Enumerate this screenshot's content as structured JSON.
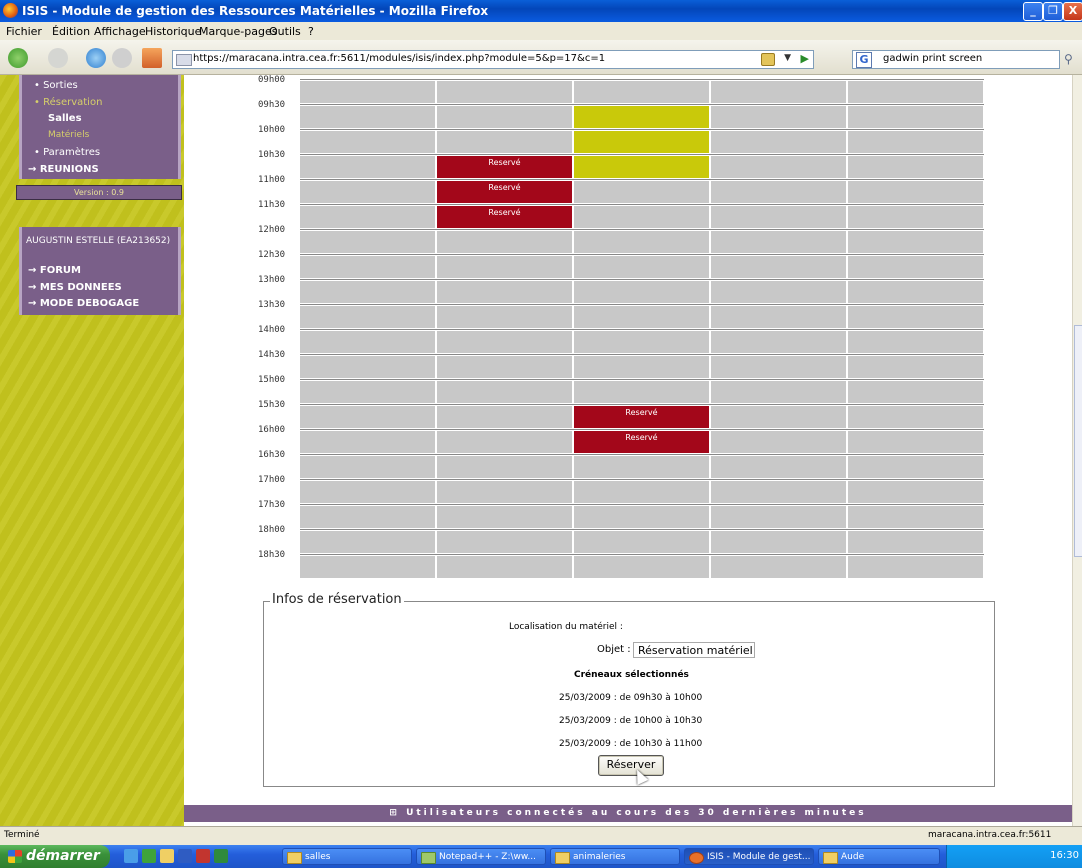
{
  "window": {
    "title": "ISIS - Module de gestion des Ressources Matérielles - Mozilla Firefox",
    "buttons": [
      "_",
      "❐",
      "X"
    ]
  },
  "menu": [
    "Fichier",
    "Édition",
    "Affichage",
    "Historique",
    "Marque-pages",
    "Outils",
    "?"
  ],
  "nav": {
    "url": "https://maracana.intra.cea.fr:5611/modules/isis/index.php?module=5&p=17&c=1",
    "search_value": "gadwin print screen",
    "search_engine": "G"
  },
  "sidebar": {
    "menu_items": [
      {
        "label": "• Sorties",
        "style": "normal"
      },
      {
        "label": "• Réservation",
        "style": "active"
      },
      {
        "label": "Salles",
        "style": "sub-bold"
      },
      {
        "label": "Matériels",
        "style": "sub-active"
      },
      {
        "label": "• Paramètres",
        "style": "normal"
      },
      {
        "label": "→ REUNIONS",
        "style": "bold"
      }
    ],
    "version": "Version : 0.9",
    "user": "AUGUSTIN ESTELLE (EA213652)",
    "user_links": [
      "→ FORUM",
      "→ MES DONNEES",
      "→ MODE DEBOGAGE"
    ]
  },
  "schedule": {
    "time_labels": [
      "09h00",
      "09h30",
      "10h00",
      "10h30",
      "11h00",
      "11h30",
      "12h00",
      "12h30",
      "13h00",
      "13h30",
      "14h00",
      "14h30",
      "15h00",
      "15h30",
      "16h00",
      "16h30",
      "17h00",
      "17h30",
      "18h00",
      "18h30"
    ],
    "columns": 5,
    "reserved_label": "Reservé",
    "reserved_cells": [
      {
        "col": 1,
        "slot": "10h30"
      },
      {
        "col": 1,
        "slot": "11h00"
      },
      {
        "col": 1,
        "slot": "11h30"
      },
      {
        "col": 2,
        "slot": "15h30"
      },
      {
        "col": 2,
        "slot": "16h00"
      }
    ],
    "selected_cells": [
      {
        "col": 2,
        "slot": "09h30"
      },
      {
        "col": 2,
        "slot": "10h00"
      },
      {
        "col": 2,
        "slot": "10h30"
      }
    ],
    "colors": {
      "free": "#c8c8c8",
      "reserved": "#a3071a",
      "selected": "#c9c90a"
    }
  },
  "infos": {
    "legend": "Infos de réservation",
    "localisation_label": "Localisation du matériel :",
    "objet_label": "Objet :",
    "objet_value": "Réservation matériel",
    "creneaux_title": "Créneaux sélectionnés",
    "creneaux": [
      "25/03/2009 : de 09h30 à 10h00",
      "25/03/2009 : de 10h00 à 10h30",
      "25/03/2009 : de 10h30 à 11h00"
    ],
    "button": "Réserver"
  },
  "footer": "⊞ Utilisateurs connectés au cours des 30 dernières minutes",
  "status": {
    "left": "Terminé",
    "right": "maracana.intra.cea.fr:5611"
  },
  "taskbar": {
    "start": "démarrer",
    "items": [
      "salles",
      "Notepad++ - Z:\\ww...",
      "animaleries",
      "ISIS - Module de gest...",
      "Aude"
    ],
    "active_index": 3,
    "clock": "16:30"
  }
}
